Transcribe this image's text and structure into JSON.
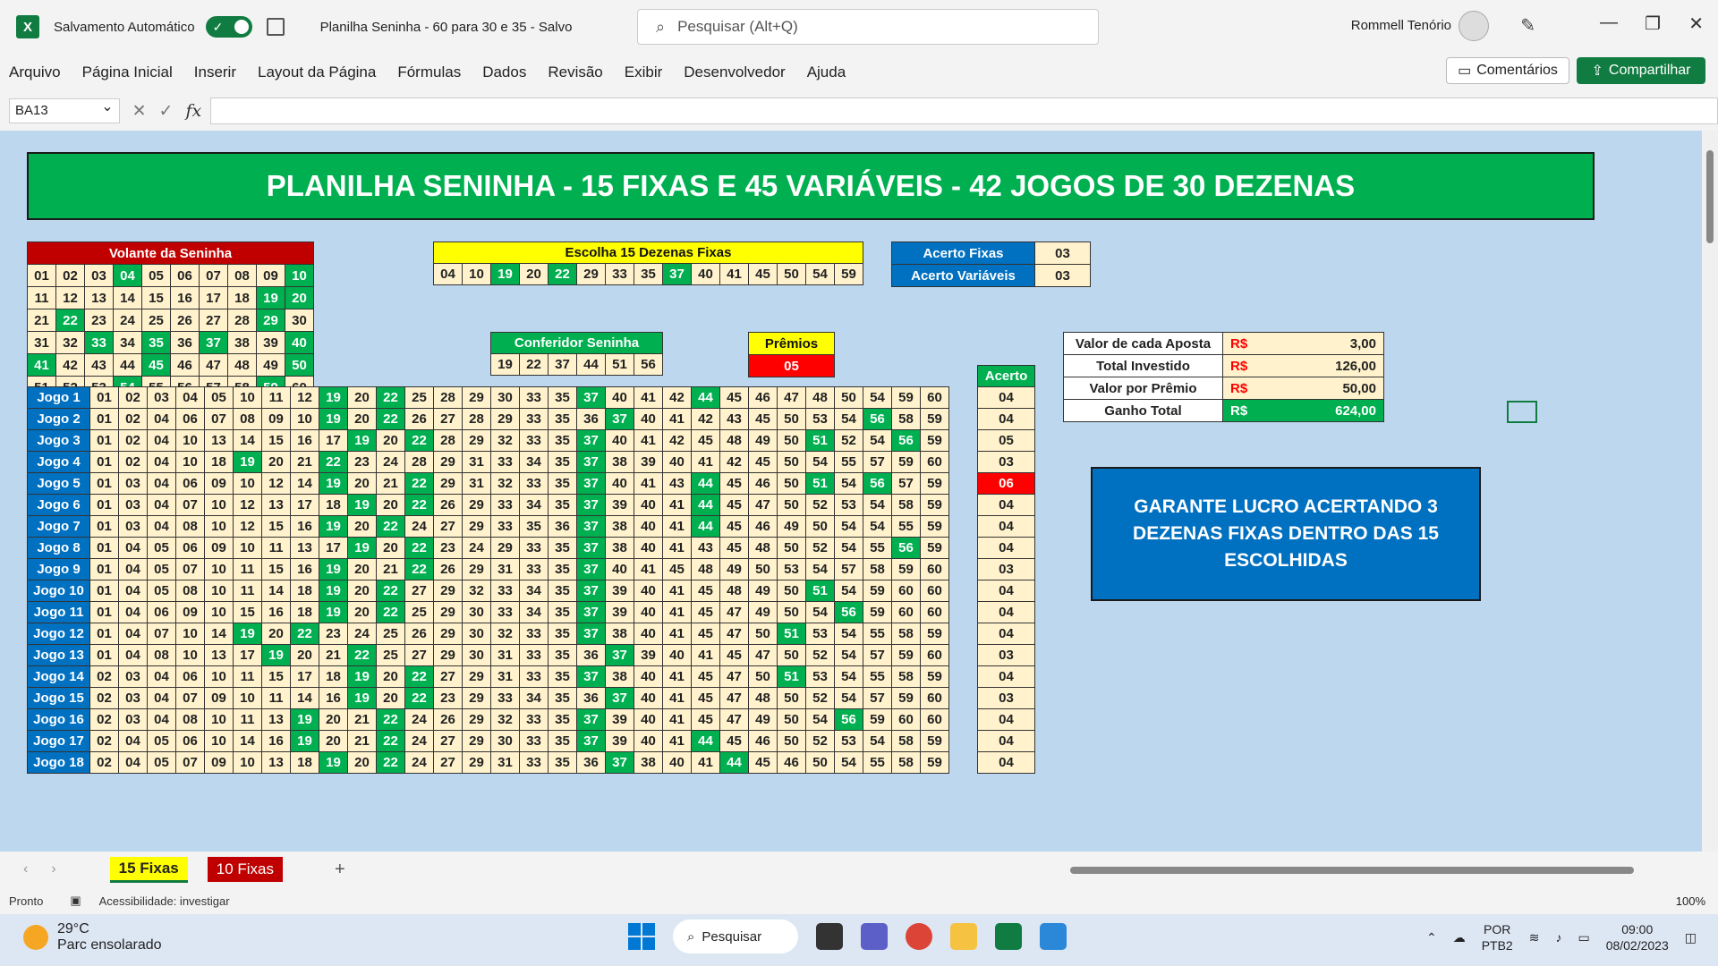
{
  "titlebar": {
    "autosave_label": "Salvamento Automático",
    "toggle_state": "✓",
    "doc_title": "Planilha Seninha - 60 para 30 e 35  -  Salvo",
    "search_placeholder": "Pesquisar (Alt+Q)",
    "user_name": "Rommell Tenório"
  },
  "menu": [
    "Arquivo",
    "Página Inicial",
    "Inserir",
    "Layout da Página",
    "Fórmulas",
    "Dados",
    "Revisão",
    "Exibir",
    "Desenvolvedor",
    "Ajuda"
  ],
  "buttons": {
    "comments": "Comentários",
    "share": "Compartilhar"
  },
  "formula_bar": {
    "name_box": "BA13",
    "formula": ""
  },
  "banner": "PLANILHA SENINHA  - 15 FIXAS E 45 VARIÁVEIS - 42 JOGOS DE 30 DEZENAS",
  "volante": {
    "title": "Volante da Seninha",
    "highlighted": [
      "04",
      "10",
      "19",
      "20",
      "22",
      "29",
      "33",
      "35",
      "37",
      "40",
      "41",
      "45",
      "50",
      "54",
      "59"
    ]
  },
  "escolha": {
    "title": "Escolha 15 Dezenas Fixas",
    "numbers": [
      "04",
      "10",
      "19",
      "20",
      "22",
      "29",
      "33",
      "35",
      "37",
      "40",
      "41",
      "45",
      "50",
      "54",
      "59"
    ],
    "highlighted": [
      "19",
      "22",
      "37"
    ]
  },
  "acerto_box": {
    "fixas_label": "Acerto Fixas",
    "fixas_value": "03",
    "variaveis_label": "Acerto Variáveis",
    "variaveis_value": "03"
  },
  "conferidor": {
    "title": "Conferidor Seninha",
    "numbers": [
      "19",
      "22",
      "37",
      "44",
      "51",
      "56"
    ]
  },
  "premios": {
    "title": "Prêmios",
    "value": "05"
  },
  "financeiro": [
    {
      "label": "Valor de cada Aposta",
      "currency": "R$",
      "value": "3,00",
      "style": "y"
    },
    {
      "label": "Total Investido",
      "currency": "R$",
      "value": "126,00",
      "style": "y"
    },
    {
      "label": "Valor por Prêmio",
      "currency": "R$",
      "value": "50,00",
      "style": "y"
    },
    {
      "label": "Ganho Total",
      "currency": "R$",
      "value": "624,00",
      "style": "g"
    }
  ],
  "acerto_header": "Acerto",
  "jogos": [
    {
      "label": "Jogo 1",
      "nums": [
        "01",
        "02",
        "03",
        "04",
        "05",
        "10",
        "11",
        "12",
        "19",
        "20",
        "22",
        "25",
        "28",
        "29",
        "30",
        "33",
        "35",
        "37",
        "40",
        "41",
        "42",
        "44",
        "45",
        "46",
        "47",
        "48",
        "50",
        "54",
        "59",
        "60"
      ],
      "acerto": "04"
    },
    {
      "label": "Jogo 2",
      "nums": [
        "01",
        "02",
        "04",
        "06",
        "07",
        "08",
        "09",
        "10",
        "19",
        "20",
        "22",
        "26",
        "27",
        "28",
        "29",
        "33",
        "35",
        "36",
        "37",
        "40",
        "41",
        "42",
        "43",
        "45",
        "50",
        "53",
        "54",
        "56",
        "58",
        "59"
      ],
      "acerto": "04"
    },
    {
      "label": "Jogo 3",
      "nums": [
        "01",
        "02",
        "04",
        "10",
        "13",
        "14",
        "15",
        "16",
        "17",
        "19",
        "20",
        "22",
        "28",
        "29",
        "32",
        "33",
        "35",
        "37",
        "40",
        "41",
        "42",
        "45",
        "48",
        "49",
        "50",
        "51",
        "52",
        "54",
        "56",
        "59"
      ],
      "acerto": "05"
    },
    {
      "label": "Jogo 4",
      "nums": [
        "01",
        "02",
        "04",
        "10",
        "18",
        "19",
        "20",
        "21",
        "22",
        "23",
        "24",
        "28",
        "29",
        "31",
        "33",
        "34",
        "35",
        "37",
        "38",
        "39",
        "40",
        "41",
        "42",
        "45",
        "50",
        "54",
        "55",
        "57",
        "59",
        "60"
      ],
      "acerto": "03"
    },
    {
      "label": "Jogo 5",
      "nums": [
        "01",
        "03",
        "04",
        "06",
        "09",
        "10",
        "12",
        "14",
        "19",
        "20",
        "21",
        "22",
        "29",
        "31",
        "32",
        "33",
        "35",
        "37",
        "40",
        "41",
        "43",
        "44",
        "45",
        "46",
        "50",
        "51",
        "54",
        "56",
        "57",
        "59"
      ],
      "acerto": "06",
      "red": true
    },
    {
      "label": "Jogo 6",
      "nums": [
        "01",
        "03",
        "04",
        "07",
        "10",
        "12",
        "13",
        "17",
        "18",
        "19",
        "20",
        "22",
        "26",
        "29",
        "33",
        "34",
        "35",
        "37",
        "39",
        "40",
        "41",
        "44",
        "45",
        "47",
        "50",
        "52",
        "53",
        "54",
        "58",
        "59"
      ],
      "acerto": "04"
    },
    {
      "label": "Jogo 7",
      "nums": [
        "01",
        "03",
        "04",
        "08",
        "10",
        "12",
        "15",
        "16",
        "19",
        "20",
        "22",
        "24",
        "27",
        "29",
        "33",
        "35",
        "36",
        "37",
        "38",
        "40",
        "41",
        "44",
        "45",
        "46",
        "49",
        "50",
        "54",
        "54",
        "55",
        "59"
      ],
      "acerto": "04"
    },
    {
      "label": "Jogo 8",
      "nums": [
        "01",
        "04",
        "05",
        "06",
        "09",
        "10",
        "11",
        "13",
        "17",
        "19",
        "20",
        "22",
        "23",
        "24",
        "29",
        "33",
        "35",
        "37",
        "38",
        "40",
        "41",
        "43",
        "45",
        "48",
        "50",
        "52",
        "54",
        "55",
        "56",
        "59"
      ],
      "acerto": "04"
    },
    {
      "label": "Jogo 9",
      "nums": [
        "01",
        "04",
        "05",
        "07",
        "10",
        "11",
        "15",
        "16",
        "19",
        "20",
        "21",
        "22",
        "26",
        "29",
        "31",
        "33",
        "35",
        "37",
        "40",
        "41",
        "45",
        "48",
        "49",
        "50",
        "53",
        "54",
        "57",
        "58",
        "59",
        "60"
      ],
      "acerto": "03"
    },
    {
      "label": "Jogo 10",
      "nums": [
        "01",
        "04",
        "05",
        "08",
        "10",
        "11",
        "14",
        "18",
        "19",
        "20",
        "22",
        "27",
        "29",
        "32",
        "33",
        "34",
        "35",
        "37",
        "39",
        "40",
        "41",
        "45",
        "48",
        "49",
        "50",
        "51",
        "54",
        "59",
        "60",
        "60"
      ],
      "acerto": "04"
    },
    {
      "label": "Jogo 11",
      "nums": [
        "01",
        "04",
        "06",
        "09",
        "10",
        "15",
        "16",
        "18",
        "19",
        "20",
        "22",
        "25",
        "29",
        "30",
        "33",
        "34",
        "35",
        "37",
        "39",
        "40",
        "41",
        "45",
        "47",
        "49",
        "50",
        "54",
        "56",
        "59",
        "60",
        "60"
      ],
      "acerto": "04"
    },
    {
      "label": "Jogo 12",
      "nums": [
        "01",
        "04",
        "07",
        "10",
        "14",
        "19",
        "20",
        "22",
        "23",
        "24",
        "25",
        "26",
        "29",
        "30",
        "32",
        "33",
        "35",
        "37",
        "38",
        "40",
        "41",
        "45",
        "47",
        "50",
        "51",
        "53",
        "54",
        "55",
        "58",
        "59"
      ],
      "acerto": "04"
    },
    {
      "label": "Jogo 13",
      "nums": [
        "01",
        "04",
        "08",
        "10",
        "13",
        "17",
        "19",
        "20",
        "21",
        "22",
        "25",
        "27",
        "29",
        "30",
        "31",
        "33",
        "35",
        "36",
        "37",
        "39",
        "40",
        "41",
        "45",
        "47",
        "50",
        "52",
        "54",
        "57",
        "59",
        "60"
      ],
      "acerto": "03"
    },
    {
      "label": "Jogo 14",
      "nums": [
        "02",
        "03",
        "04",
        "06",
        "10",
        "11",
        "15",
        "17",
        "18",
        "19",
        "20",
        "22",
        "27",
        "29",
        "31",
        "33",
        "35",
        "37",
        "38",
        "40",
        "41",
        "45",
        "47",
        "50",
        "51",
        "53",
        "54",
        "55",
        "58",
        "59"
      ],
      "acerto": "04"
    },
    {
      "label": "Jogo 15",
      "nums": [
        "02",
        "03",
        "04",
        "07",
        "09",
        "10",
        "11",
        "14",
        "16",
        "19",
        "20",
        "22",
        "23",
        "29",
        "33",
        "34",
        "35",
        "36",
        "37",
        "40",
        "41",
        "45",
        "47",
        "48",
        "50",
        "52",
        "54",
        "57",
        "59",
        "60"
      ],
      "acerto": "03"
    },
    {
      "label": "Jogo 16",
      "nums": [
        "02",
        "03",
        "04",
        "08",
        "10",
        "11",
        "13",
        "19",
        "20",
        "21",
        "22",
        "24",
        "26",
        "29",
        "32",
        "33",
        "35",
        "37",
        "39",
        "40",
        "41",
        "45",
        "47",
        "49",
        "50",
        "54",
        "56",
        "59",
        "60",
        "60"
      ],
      "acerto": "04"
    },
    {
      "label": "Jogo 17",
      "nums": [
        "02",
        "04",
        "05",
        "06",
        "10",
        "14",
        "16",
        "19",
        "20",
        "21",
        "22",
        "24",
        "27",
        "29",
        "30",
        "33",
        "35",
        "37",
        "39",
        "40",
        "41",
        "44",
        "45",
        "46",
        "50",
        "52",
        "53",
        "54",
        "58",
        "59"
      ],
      "acerto": "04"
    },
    {
      "label": "Jogo 18",
      "nums": [
        "02",
        "04",
        "05",
        "07",
        "09",
        "10",
        "13",
        "18",
        "19",
        "20",
        "22",
        "24",
        "27",
        "29",
        "31",
        "33",
        "35",
        "36",
        "37",
        "38",
        "40",
        "41",
        "44",
        "45",
        "46",
        "50",
        "54",
        "55",
        "58",
        "59"
      ],
      "acerto": "04"
    }
  ],
  "jogos_highlight": [
    "19",
    "22",
    "37",
    "44",
    "51",
    "56"
  ],
  "bluebox": "GARANTE LUCRO ACERTANDO 3 DEZENAS FIXAS DENTRO DAS 15 ESCOLHIDAS",
  "sheet_tabs": [
    "15 Fixas",
    "10 Fixas"
  ],
  "status": {
    "ready": "Pronto",
    "accessibility": "Acessibilidade: investigar",
    "zoom": "100%"
  },
  "taskbar": {
    "temp": "29°C",
    "weather": "Parc ensolarado",
    "search": "Pesquisar",
    "lang1": "POR",
    "lang2": "PTB2",
    "time": "09:00",
    "date": "08/02/2023"
  }
}
